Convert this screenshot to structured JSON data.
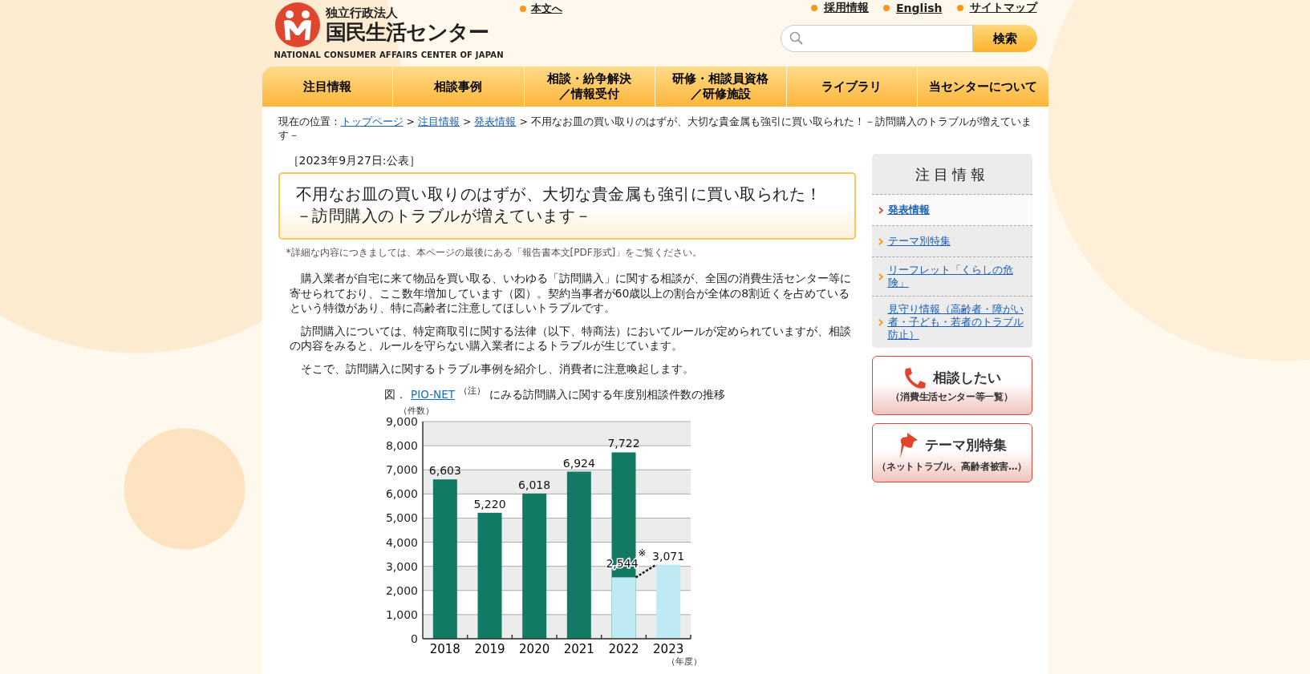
{
  "header": {
    "logo": {
      "kicker": "独立行政法人",
      "name": "国民生活センター",
      "english": "NATIONAL CONSUMER AFFAIRS CENTER OF JAPAN"
    },
    "skip_link": "本文へ",
    "top_links": [
      "採用情報",
      "English",
      "サイトマップ"
    ],
    "search": {
      "button": "検索"
    }
  },
  "nav": [
    {
      "lines": [
        "注目情報"
      ]
    },
    {
      "lines": [
        "相談事例"
      ]
    },
    {
      "lines": [
        "相談・紛争解決",
        "／情報受付"
      ]
    },
    {
      "lines": [
        "研修・相談員資格",
        "／研修施設"
      ]
    },
    {
      "lines": [
        "ライブラリ"
      ]
    },
    {
      "lines": [
        "当センターについて"
      ]
    }
  ],
  "breadcrumb": {
    "label": "現在の位置：",
    "links": [
      "トップページ",
      "注目情報",
      "発表情報"
    ],
    "separator": ">",
    "current": "不用なお皿の買い取りのはずが、大切な貴金属も強引に買い取られた！－訪問購入のトラブルが増えています－"
  },
  "article": {
    "date": "［2023年9月27日:公表］",
    "title": "不用なお皿の買い取りのはずが、大切な貴金属も強引に買い取られた！－訪問購入のトラブルが増えています－",
    "note": "*詳細な内容につきましては、本ページの最後にある「報告書本文[PDF形式]」をご覧ください。",
    "paragraphs": [
      "購入業者が自宅に来て物品を買い取る、いわゆる「訪問購入」に関する相談が、全国の消費生活センター等に寄せられており、ここ数年増加しています（図）。契約当事者が60歳以上の割合が全体の8割近くを占めているという特徴があり、特に高齢者に注意してほしいトラブルです。",
      "訪問購入については、特定商取引に関する法律（以下、特商法）においてルールが定められていますが、相談の内容をみると、ルールを守らない購入業者によるトラブルが生じています。",
      "そこで、訪問購入に関するトラブル事例を紹介し、消費者に注意喚起します。"
    ],
    "figure": {
      "prefix": "図．",
      "link": "PIO-NET",
      "note_mark": "（注）",
      "caption": "にみる訪問購入に関する年度別相談件数の推移",
      "chart_data": {
        "type": "bar",
        "ylabel": "（件数）",
        "xlabel": "（年度）",
        "categories": [
          "2018",
          "2019",
          "2020",
          "2021",
          "2022",
          "2023"
        ],
        "series": [
          {
            "color": "#127a62",
            "values": [
              6603,
              5220,
              6018,
              6924,
              7722,
              null
            ],
            "value_labels": [
              "6,603",
              "5,220",
              "6,018",
              "6,924",
              "7,722",
              null
            ]
          },
          {
            "color": "#bfe9f3",
            "values": [
              null,
              null,
              null,
              null,
              2544,
              3071
            ],
            "value_labels": [
              null,
              null,
              null,
              null,
              "2,544",
              "3,071"
            ]
          }
        ],
        "grid": true,
        "ylim": [
          0,
          9000
        ],
        "yticks": [
          {
            "value": 0,
            "label": "0"
          },
          {
            "value": 1000,
            "label": "1,000"
          },
          {
            "value": 2000,
            "label": "2,000"
          },
          {
            "value": 3000,
            "label": "3,000"
          },
          {
            "value": 4000,
            "label": "4,000"
          },
          {
            "value": 5000,
            "label": "5,000"
          },
          {
            "value": 6000,
            "label": "6,000"
          },
          {
            "value": 7000,
            "label": "7,000"
          },
          {
            "value": 8000,
            "label": "8,000"
          },
          {
            "value": 9000,
            "label": "9,000"
          }
        ],
        "annotations": [
          {
            "text": "※"
          }
        ]
      }
    }
  },
  "sidebar": {
    "title": "注目情報",
    "items": [
      {
        "label": "発表情報",
        "selected": true
      },
      {
        "label": "テーマ別特集",
        "selected": false
      },
      {
        "label": "リーフレット「くらしの危険」",
        "selected": false
      },
      {
        "label": "見守り情報（高齢者・障がい者・子ども・若者のトラブル防止）",
        "selected": false
      }
    ],
    "banners": [
      {
        "kind": "phone",
        "title": "相談したい",
        "subtitle": "（消費生活センター等一覧）"
      },
      {
        "kind": "pin",
        "title": "テーマ別特集",
        "subtitle": "（ネットトラブル、高齢者被害…）"
      }
    ]
  }
}
